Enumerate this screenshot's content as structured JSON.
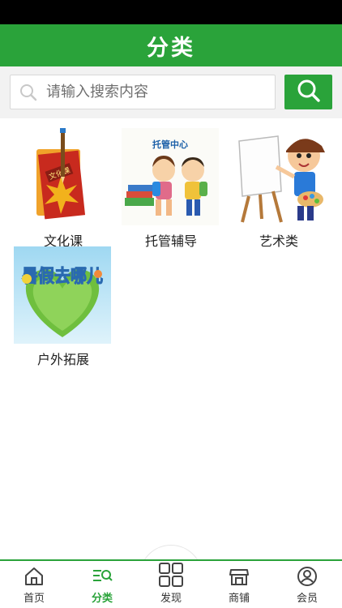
{
  "header": {
    "title": "分类"
  },
  "search": {
    "placeholder": "请输入搜索内容"
  },
  "categories": [
    {
      "label": "文化课",
      "image_text": "文化课",
      "icon": "book-leaf-pencil"
    },
    {
      "label": "托管辅导",
      "image_text": "托管中心",
      "icon": "kids-backpacks"
    },
    {
      "label": "艺术类",
      "image_text": "",
      "icon": "boy-painter"
    },
    {
      "label": "户外拓展",
      "image_text": "暑假去哪儿",
      "icon": "summer-heart"
    }
  ],
  "tabs": [
    {
      "label": "首页",
      "icon": "home-icon"
    },
    {
      "label": "分类",
      "icon": "category-icon",
      "active": true
    },
    {
      "label": "发现",
      "icon": "grid-icon"
    },
    {
      "label": "商铺",
      "icon": "store-icon"
    },
    {
      "label": "会员",
      "icon": "user-icon"
    }
  ],
  "colors": {
    "brand": "#2aa33a"
  }
}
